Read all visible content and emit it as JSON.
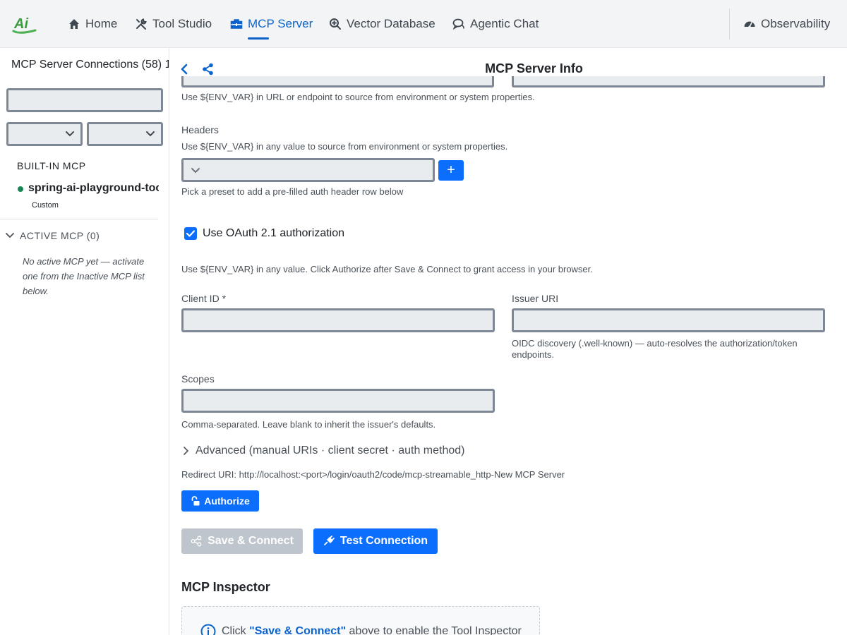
{
  "nav": {
    "logo_text": "Ai",
    "items": [
      {
        "label": "Home",
        "icon": "home-icon"
      },
      {
        "label": "Tool Studio",
        "icon": "tools-icon"
      },
      {
        "label": "MCP Server",
        "icon": "toolbox-icon",
        "active": true
      },
      {
        "label": "Vector Database",
        "icon": "search-plus-icon"
      },
      {
        "label": "Agentic Chat",
        "icon": "chat-icon"
      },
      {
        "label": "Observability",
        "icon": "gauge-icon"
      }
    ]
  },
  "sidebar": {
    "title": "MCP Server Connections (58) 1",
    "search_value": "",
    "filter1_value": "",
    "filter2_value": "",
    "builtin_heading": "BUILT-IN MCP",
    "builtin_server_name": "spring-ai-playground-tool-mcp",
    "builtin_server_type": "Custom",
    "active_heading": "ACTIVE MCP (0)",
    "active_empty": "No active MCP yet — activate one from the Inactive MCP list below."
  },
  "panel": {
    "title": "MCP Server Info",
    "env_hint_url": "Use ${ENV_VAR} in URL or endpoint to source from environment or system properties.",
    "headers_label": "Headers",
    "headers_hint": "Use ${ENV_VAR} in any value to source from environment or system properties.",
    "headers_preset_value": "",
    "headers_preset_hint": "Pick a preset to add a pre-filled auth header row below",
    "add_header_label": "+",
    "oauth_checked": true,
    "oauth_label": "Use OAuth 2.1 authorization",
    "oauth_hint": "Use ${ENV_VAR} in any value. Click Authorize after Save & Connect to grant access in your browser.",
    "client_id_label": "Client ID *",
    "client_id_value": "",
    "issuer_label": "Issuer URI",
    "issuer_value": "",
    "issuer_hint_line1": "OIDC discovery (.well-known) — auto-resolves the authorization/token",
    "issuer_hint_line2": "endpoints.",
    "scopes_label": "Scopes",
    "scopes_value": "",
    "scopes_hint": "Comma-separated. Leave blank to inherit the issuer's defaults.",
    "advanced_label": "Advanced (manual URIs · client secret · auth method)",
    "redirect_uri": "Redirect URI: http://localhost:<port>/login/oauth2/code/mcp-streamable_http-New MCP Server",
    "authorize_label": "Authorize",
    "save_connect_label": "Save & Connect",
    "test_connection_label": "Test Connection"
  },
  "inspector": {
    "title": "MCP Inspector",
    "hint_prefix": "Click ",
    "hint_link": "\"Save & Connect\"",
    "hint_suffix": " above to enable the Tool Inspector"
  },
  "colors": {
    "accent": "#0b6efd",
    "nav_active": "#0b63ce",
    "status_online": "#198754",
    "disabled_button": "#b8bfc8"
  }
}
